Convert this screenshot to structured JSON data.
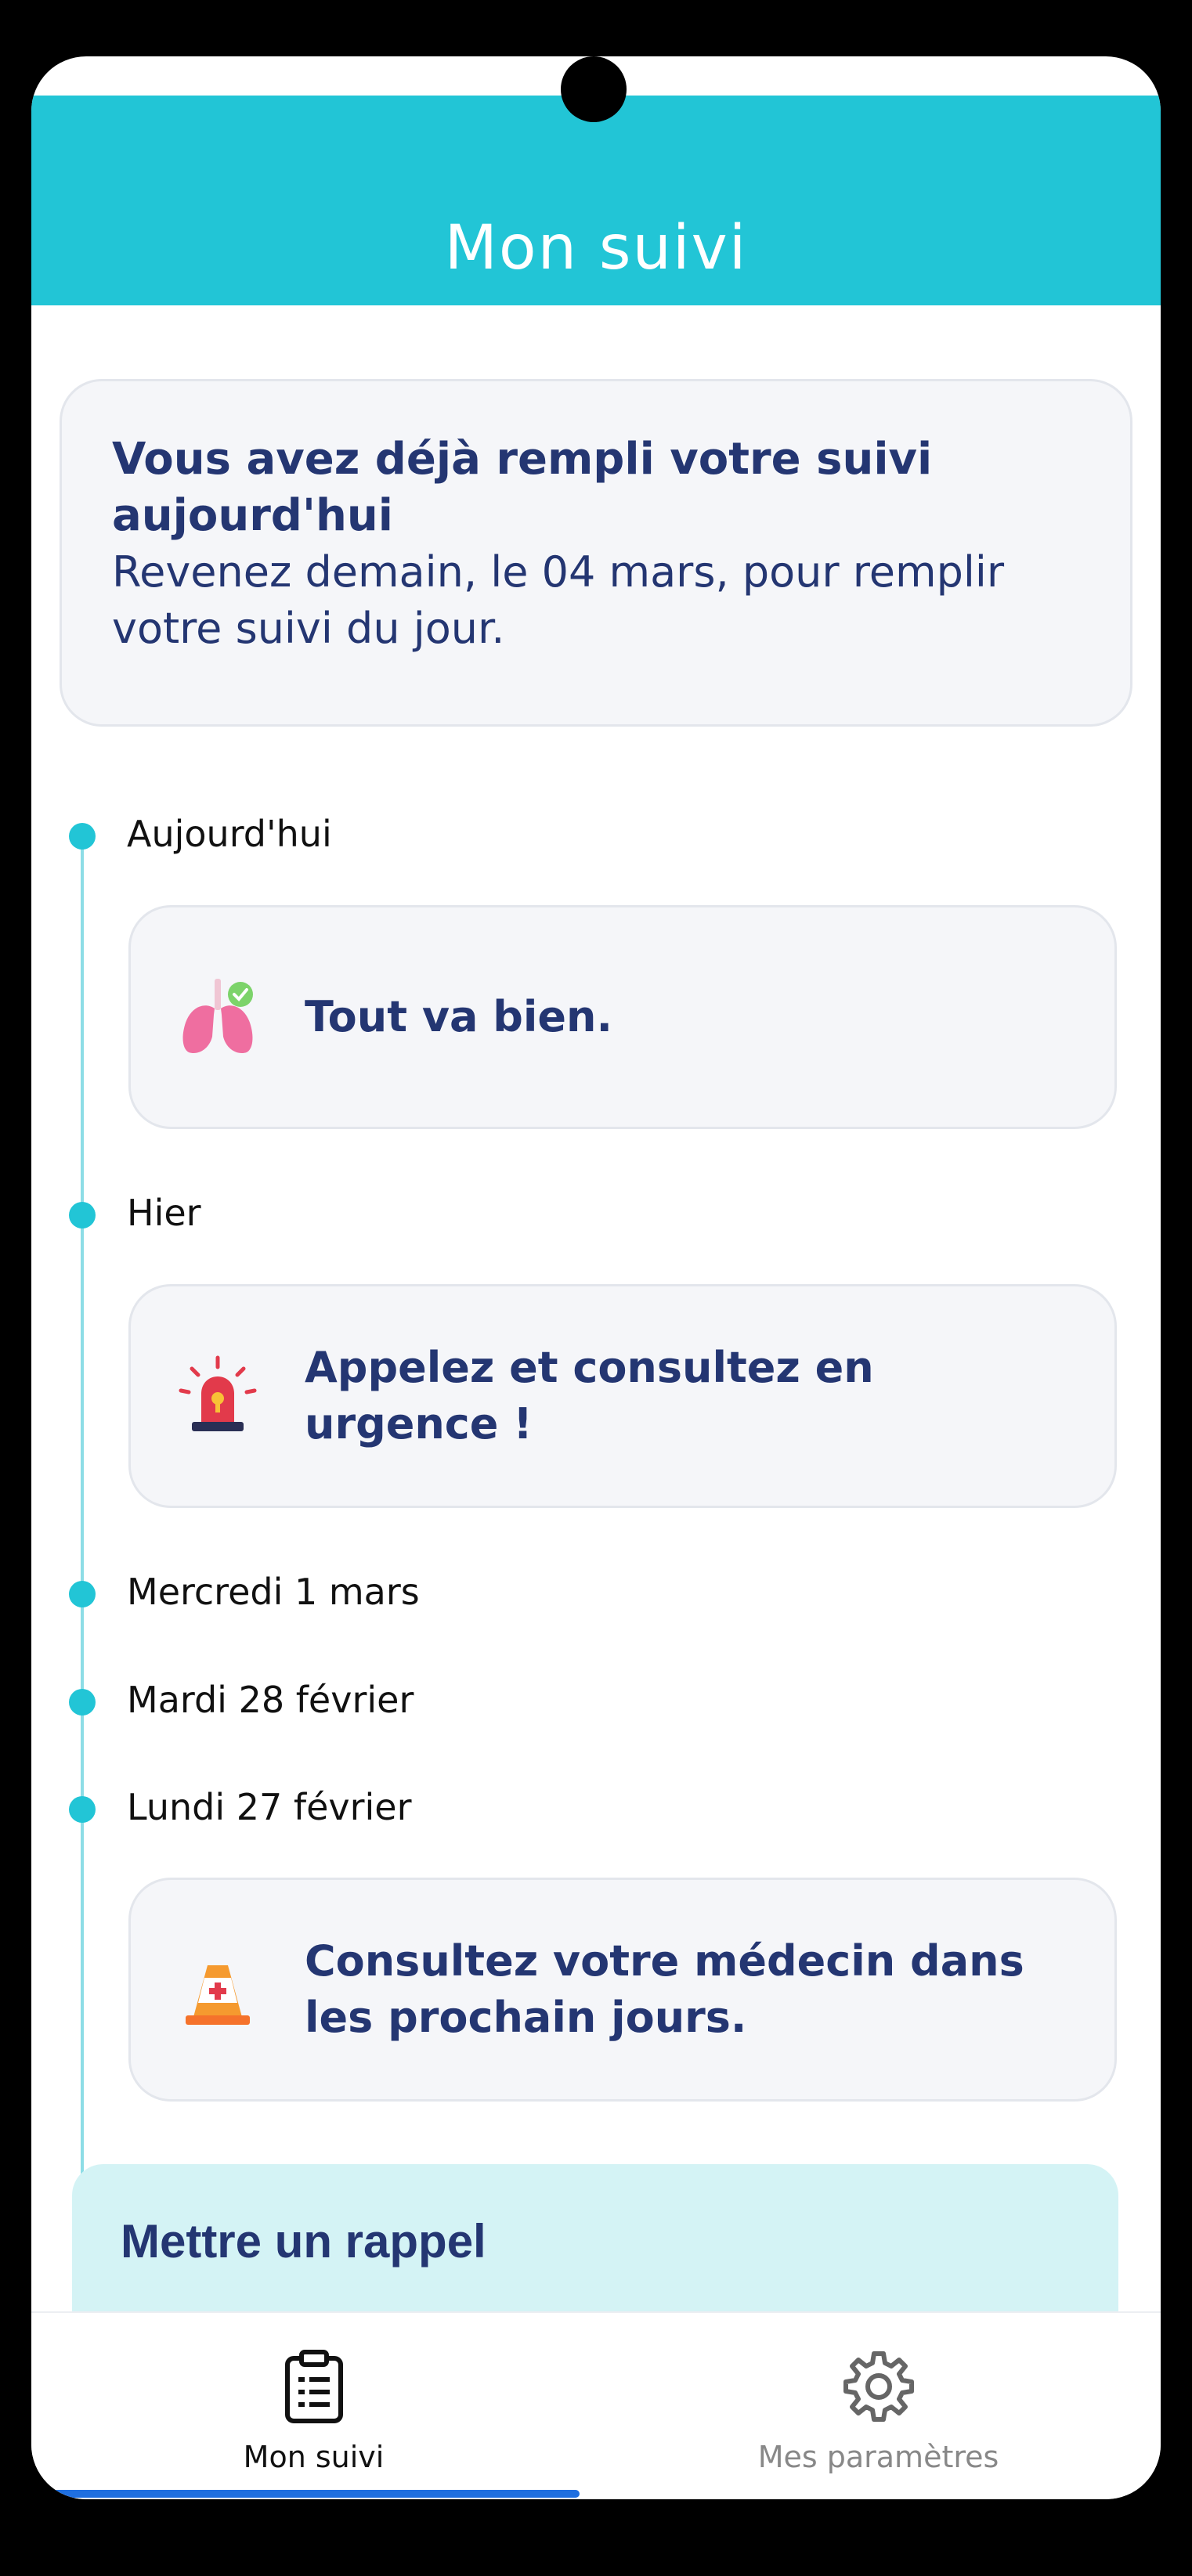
{
  "header": {
    "title": "Mon suivi"
  },
  "notice": {
    "title": "Vous avez déjà rempli votre suivi aujourd'hui",
    "body": "Revenez demain, le 04 mars, pour remplir votre suivi du jour."
  },
  "timeline": [
    {
      "date": "Aujourd'hui",
      "message": "Tout va bien.",
      "icon": "lungs-check-icon"
    },
    {
      "date": "Hier",
      "message": "Appelez et consultez en urgence !",
      "icon": "siren-icon"
    },
    {
      "date": "Mercredi 1 mars"
    },
    {
      "date": "Mardi 28 février"
    },
    {
      "date": "Lundi 27 février",
      "message": "Consultez votre médecin dans les prochain jours.",
      "icon": "medical-cone-icon"
    }
  ],
  "reminder": {
    "title": "Mettre un rappel"
  },
  "bottom_nav": [
    {
      "label": "Mon suivi",
      "icon": "clipboard-icon",
      "active": true
    },
    {
      "label": "Mes paramètres",
      "icon": "gear-icon",
      "active": false
    }
  ],
  "colors": {
    "accent": "#22c5d6",
    "primary_text": "#243672",
    "active_tab": "#1f6fe0",
    "card_bg": "#f5f6f9"
  }
}
